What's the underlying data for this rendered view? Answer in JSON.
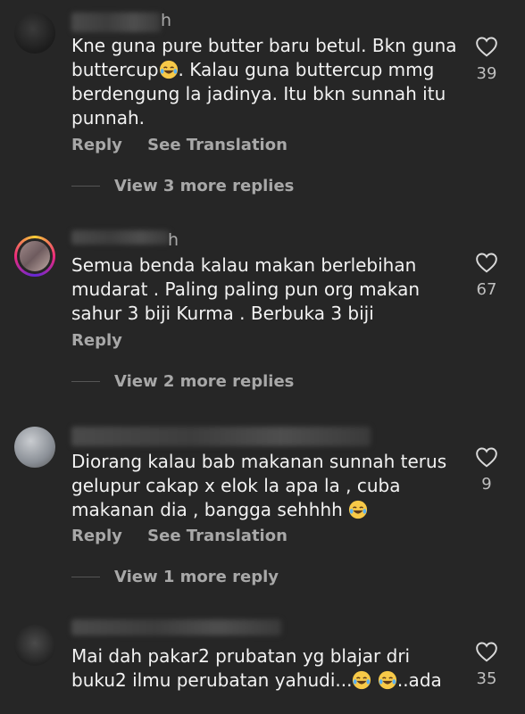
{
  "comments": [
    {
      "time": "h",
      "lines": [
        "Kne guna pure butter baru betul. Bkn guna",
        "buttercup",
        ". Kalau guna buttercup mmg",
        "berdengung la jadinya. Itu bkn sunnah itu",
        "punnah."
      ],
      "emoji_icon": "laughing-tears-icon",
      "likes": "39",
      "actions": [
        "Reply",
        "See Translation"
      ],
      "view_replies": "View 3 more replies"
    },
    {
      "time": "h",
      "lines": [
        "Semua benda kalau makan berlebihan",
        "mudarat . Paling paling pun org makan",
        "sahur 3 biji Kurma . Berbuka 3 biji"
      ],
      "likes": "67",
      "actions": [
        "Reply"
      ],
      "view_replies": "View 2 more replies"
    },
    {
      "lines": [
        "Diorang kalau bab makanan sunnah terus",
        "gelupur cakap x elok la apa la , cuba",
        "makanan dia , bangga sehhhh"
      ],
      "emoji_icon": "laughing-tears-icon",
      "likes": "9",
      "actions": [
        "Reply",
        "See Translation"
      ],
      "view_replies": "View 1 more reply"
    },
    {
      "lines": [
        "Mai dah pakar2 prubatan yg blajar dri",
        "buku2 ilmu perubatan yahudi...",
        "..ada"
      ],
      "emoji_icon": "laughing-tears-icon",
      "likes": "35"
    }
  ],
  "colors": {
    "background": "#262626",
    "text": "#f2f2f2",
    "secondary": "#a8a8a8"
  }
}
